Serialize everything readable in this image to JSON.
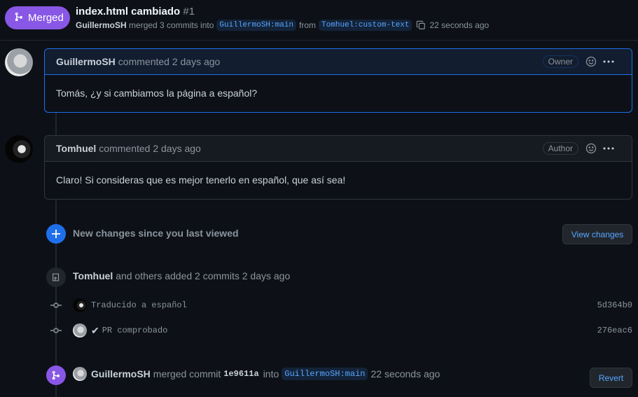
{
  "header": {
    "state_label": "Merged",
    "title": "index.html cambiado",
    "number": "#1",
    "meta": {
      "author": "GuillermoSH",
      "action": "merged 3 commits into",
      "base_branch": "GuillermoSH:main",
      "from_label": "from",
      "head_branch": "Tomhuel:custom-text",
      "time": "22 seconds ago"
    }
  },
  "comments": [
    {
      "author": "GuillermoSH",
      "time": "commented 2 days ago",
      "role": "Owner",
      "body": "Tomás, ¿y si cambiamos la página a español?"
    },
    {
      "author": "Tomhuel",
      "time": "commented 2 days ago",
      "role": "Author",
      "body": "Claro! Si consideras que es mejor tenerlo en español, que así sea!"
    }
  ],
  "new_changes": {
    "text": "New changes since you last viewed",
    "button": "View changes"
  },
  "commits_group": {
    "author": "Tomhuel",
    "text": "and others added 2 commits 2 days ago",
    "commits": [
      {
        "message": "Traducido a español",
        "sha": "5d364b0",
        "checked": false
      },
      {
        "message": "PR comprobado",
        "sha": "276eac6",
        "checked": true,
        "check": "✔"
      }
    ]
  },
  "merge_event": {
    "author": "GuillermoSH",
    "action": "merged commit",
    "sha": "1e9611a",
    "into": "into",
    "branch": "GuillermoSH:main",
    "time": "22 seconds ago",
    "button": "Revert"
  },
  "colors": {
    "background": "#0d1117",
    "merged_purple": "#8957e5",
    "accent_blue": "#1f6feb",
    "link_blue": "#58a6ff"
  }
}
